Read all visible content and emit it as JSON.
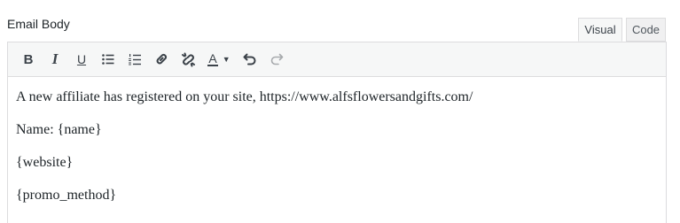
{
  "field": {
    "label": "Email Body"
  },
  "tabs": [
    {
      "label": "Visual",
      "active": true
    },
    {
      "label": "Code",
      "active": false
    }
  ],
  "toolbar": {
    "bold": "B",
    "italic": "I",
    "underline": "U",
    "text_color": "A",
    "caret": "▼",
    "icons": [
      "bold-icon",
      "italic-icon",
      "underline-icon",
      "bulleted-list-icon",
      "numbered-list-icon",
      "link-icon",
      "unlink-icon",
      "text-color-icon",
      "undo-icon",
      "redo-icon"
    ]
  },
  "content": {
    "paragraphs": [
      "A new affiliate has registered on your site, https://www.alfsflowersandgifts.com/",
      "Name: {name}",
      "{website}",
      "{promo_method}"
    ]
  },
  "colors": {
    "border": "#dcdcde",
    "toolbar_bg": "#f6f7f7",
    "text": "#1d2327",
    "icon": "#3c434a",
    "disabled_icon": "#a7aaad"
  }
}
